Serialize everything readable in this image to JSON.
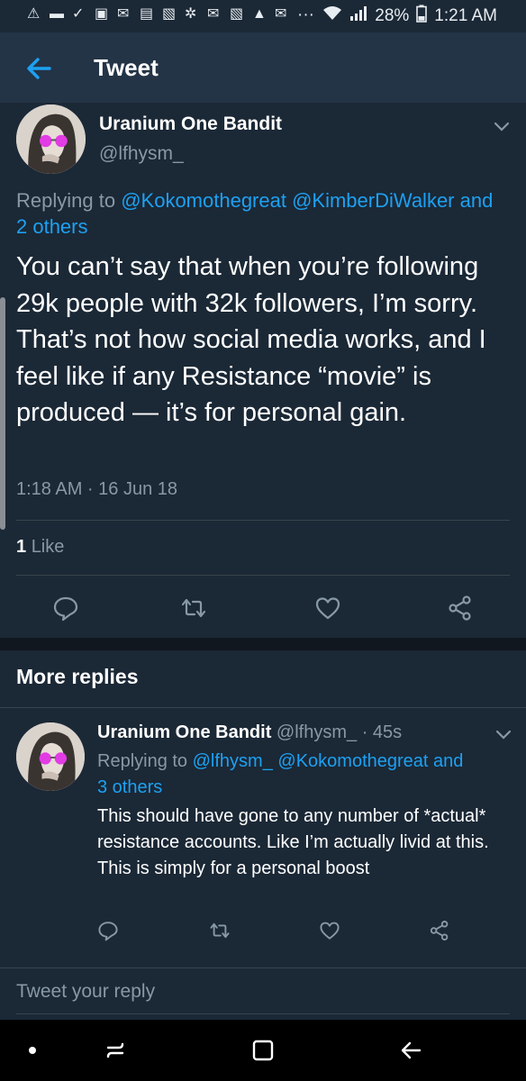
{
  "status_bar": {
    "battery": "28%",
    "time": "1:21 AM",
    "more": "···"
  },
  "header": {
    "title": "Tweet"
  },
  "main_tweet": {
    "name": "Uranium One Bandit",
    "handle": "@lfhysm_",
    "replying_prefix": "Replying to",
    "replying_mentions": "@Kokomothegreat @KimberDiWalker and",
    "replying_others": "2 others",
    "text": "You can’t say that when you’re following 29k people with 32k followers, I’m sorry. That’s not how social media works, and I feel like if any Resistance “movie” is produced — it’s for personal gain.",
    "timestamp": "1:18 AM · 16 Jun 18",
    "like_count": "1",
    "like_label": "Like"
  },
  "more_replies": {
    "heading": "More replies"
  },
  "reply": {
    "name": "Uranium One Bandit",
    "handle_time": "@lfhysm_ · 45s",
    "replying_prefix": "Replying to",
    "replying_mentions": "@lfhysm_ @Kokomothegreat and",
    "replying_others": "3 others",
    "text": "This should have gone to any number of *actual* resistance accounts. Like I’m actually livid at this. This is simply for a personal boost"
  },
  "composer": {
    "placeholder": "Tweet your reply"
  },
  "colors": {
    "background": "#1b2836",
    "header": "#243447",
    "link": "#1da1f2",
    "muted": "#8899a6"
  }
}
